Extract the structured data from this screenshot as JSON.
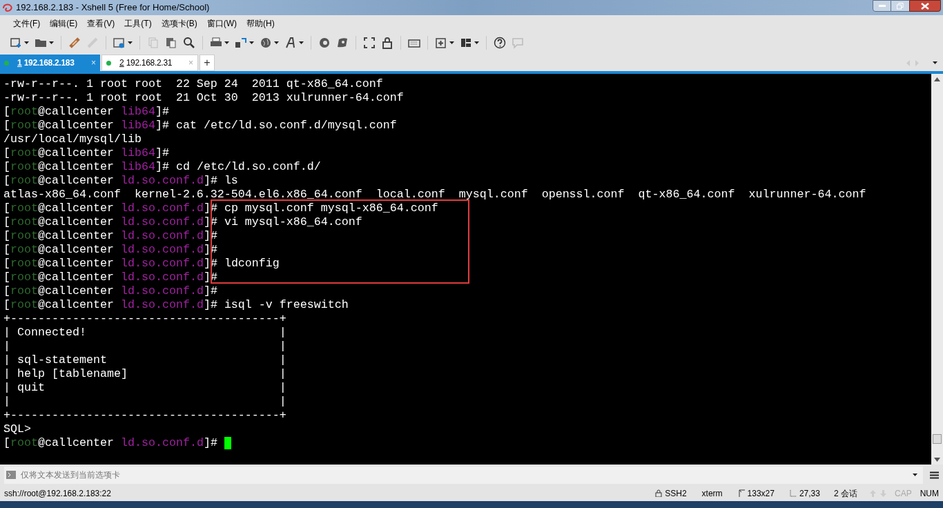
{
  "window": {
    "title": "192.168.2.183 - Xshell 5 (Free for Home/School)"
  },
  "menu": [
    "文件(F)",
    "编辑(E)",
    "查看(V)",
    "工具(T)",
    "选项卡(B)",
    "窗口(W)",
    "帮助(H)"
  ],
  "tabs": [
    {
      "number": "1",
      "label": "192.168.2.183",
      "selected": true,
      "close": "×",
      "color": "#22b14c"
    },
    {
      "number": "2",
      "label": "192.168.2.31",
      "selected": false,
      "close": "×",
      "color": "#22b14c"
    }
  ],
  "new_tab": "+",
  "terminal": {
    "lines": [
      [
        {
          "text": "-rw-r--r--. 1 root root  22 Sep 24  2011 qt-x86_64.conf",
          "color": "#ffffff"
        }
      ],
      [
        {
          "text": "-rw-r--r--. 1 root root  21 Oct 30  2013 xulrunner-64.conf",
          "color": "#ffffff"
        }
      ],
      [
        {
          "text": "[",
          "color": "#ffffff"
        },
        {
          "text": "root",
          "color": "#2e6b2e"
        },
        {
          "text": "@callcenter ",
          "color": "#ffffff"
        },
        {
          "text": "lib64",
          "color": "#a020a0"
        },
        {
          "text": "]#",
          "color": "#ffffff"
        }
      ],
      [
        {
          "text": "[",
          "color": "#ffffff"
        },
        {
          "text": "root",
          "color": "#2e6b2e"
        },
        {
          "text": "@callcenter ",
          "color": "#ffffff"
        },
        {
          "text": "lib64",
          "color": "#a020a0"
        },
        {
          "text": "]# cat /etc/ld.so.conf.d/mysql.conf",
          "color": "#ffffff"
        }
      ],
      [
        {
          "text": "/usr/local/mysql/lib",
          "color": "#ffffff"
        }
      ],
      [
        {
          "text": "[",
          "color": "#ffffff"
        },
        {
          "text": "root",
          "color": "#2e6b2e"
        },
        {
          "text": "@callcenter ",
          "color": "#ffffff"
        },
        {
          "text": "lib64",
          "color": "#a020a0"
        },
        {
          "text": "]#",
          "color": "#ffffff"
        }
      ],
      [
        {
          "text": "[",
          "color": "#ffffff"
        },
        {
          "text": "root",
          "color": "#2e6b2e"
        },
        {
          "text": "@callcenter ",
          "color": "#ffffff"
        },
        {
          "text": "lib64",
          "color": "#a020a0"
        },
        {
          "text": "]# cd /etc/ld.so.conf.d/",
          "color": "#ffffff"
        }
      ],
      [
        {
          "text": "[",
          "color": "#ffffff"
        },
        {
          "text": "root",
          "color": "#2e6b2e"
        },
        {
          "text": "@callcenter ",
          "color": "#ffffff"
        },
        {
          "text": "ld.so.conf.d",
          "color": "#a020a0"
        },
        {
          "text": "]# ls",
          "color": "#ffffff"
        }
      ],
      [
        {
          "text": "atlas-x86_64.conf  kernel-2.6.32-504.el6.x86_64.conf  local.conf  mysql.conf  openssl.conf  qt-x86_64.conf  xulrunner-64.conf",
          "color": "#ffffff"
        }
      ],
      [
        {
          "text": "[",
          "color": "#ffffff"
        },
        {
          "text": "root",
          "color": "#2e6b2e"
        },
        {
          "text": "@callcenter ",
          "color": "#ffffff"
        },
        {
          "text": "ld.so.conf.d",
          "color": "#a020a0"
        },
        {
          "text": "]",
          "color": "#ffffff"
        },
        {
          "text": "# cp mysql.conf mysql-x86_64.conf",
          "color": "#ffffff"
        }
      ],
      [
        {
          "text": "[",
          "color": "#ffffff"
        },
        {
          "text": "root",
          "color": "#2e6b2e"
        },
        {
          "text": "@callcenter ",
          "color": "#ffffff"
        },
        {
          "text": "ld.so.conf.d",
          "color": "#a020a0"
        },
        {
          "text": "]",
          "color": "#ffffff"
        },
        {
          "text": "# vi mysql-x86_64.conf",
          "color": "#ffffff"
        }
      ],
      [
        {
          "text": "[",
          "color": "#ffffff"
        },
        {
          "text": "root",
          "color": "#2e6b2e"
        },
        {
          "text": "@callcenter ",
          "color": "#ffffff"
        },
        {
          "text": "ld.so.conf.d",
          "color": "#a020a0"
        },
        {
          "text": "]",
          "color": "#ffffff"
        },
        {
          "text": "#",
          "color": "#ffffff"
        }
      ],
      [
        {
          "text": "[",
          "color": "#ffffff"
        },
        {
          "text": "root",
          "color": "#2e6b2e"
        },
        {
          "text": "@callcenter ",
          "color": "#ffffff"
        },
        {
          "text": "ld.so.conf.d",
          "color": "#a020a0"
        },
        {
          "text": "]",
          "color": "#ffffff"
        },
        {
          "text": "#",
          "color": "#ffffff"
        }
      ],
      [
        {
          "text": "[",
          "color": "#ffffff"
        },
        {
          "text": "root",
          "color": "#2e6b2e"
        },
        {
          "text": "@callcenter ",
          "color": "#ffffff"
        },
        {
          "text": "ld.so.conf.d",
          "color": "#a020a0"
        },
        {
          "text": "]",
          "color": "#ffffff"
        },
        {
          "text": "# ldconfig",
          "color": "#ffffff"
        }
      ],
      [
        {
          "text": "[",
          "color": "#ffffff"
        },
        {
          "text": "root",
          "color": "#2e6b2e"
        },
        {
          "text": "@callcenter ",
          "color": "#ffffff"
        },
        {
          "text": "ld.so.conf.d",
          "color": "#a020a0"
        },
        {
          "text": "]",
          "color": "#ffffff"
        },
        {
          "text": "#",
          "color": "#ffffff"
        }
      ],
      [
        {
          "text": "[",
          "color": "#ffffff"
        },
        {
          "text": "root",
          "color": "#2e6b2e"
        },
        {
          "text": "@callcenter ",
          "color": "#ffffff"
        },
        {
          "text": "ld.so.conf.d",
          "color": "#a020a0"
        },
        {
          "text": "]#",
          "color": "#ffffff"
        }
      ],
      [
        {
          "text": "[",
          "color": "#ffffff"
        },
        {
          "text": "root",
          "color": "#2e6b2e"
        },
        {
          "text": "@callcenter ",
          "color": "#ffffff"
        },
        {
          "text": "ld.so.conf.d",
          "color": "#a020a0"
        },
        {
          "text": "]# isql -v freeswitch",
          "color": "#ffffff"
        }
      ],
      [
        {
          "text": "+---------------------------------------+",
          "color": "#ffffff"
        }
      ],
      [
        {
          "text": "| Connected!                            |",
          "color": "#ffffff"
        }
      ],
      [
        {
          "text": "|                                       |",
          "color": "#ffffff"
        }
      ],
      [
        {
          "text": "| sql-statement                         |",
          "color": "#ffffff"
        }
      ],
      [
        {
          "text": "| help [tablename]                      |",
          "color": "#ffffff"
        }
      ],
      [
        {
          "text": "| quit                                  |",
          "color": "#ffffff"
        }
      ],
      [
        {
          "text": "|                                       |",
          "color": "#ffffff"
        }
      ],
      [
        {
          "text": "+---------------------------------------+",
          "color": "#ffffff"
        }
      ],
      [
        {
          "text": "SQL>",
          "color": "#ffffff"
        }
      ],
      [
        {
          "text": "[",
          "color": "#ffffff"
        },
        {
          "text": "root",
          "color": "#2e6b2e"
        },
        {
          "text": "@callcenter ",
          "color": "#ffffff"
        },
        {
          "text": "ld.so.conf.d",
          "color": "#a020a0"
        },
        {
          "text": "]# ",
          "color": "#ffffff"
        }
      ]
    ]
  },
  "compose_bar": {
    "placeholder": "仅将文本发送到当前选项卡"
  },
  "status_bar": {
    "connection": "ssh://root@192.168.2.183:22",
    "protocol": "SSH2",
    "terminal_type": "xterm",
    "size": "133x27",
    "cursor": "27,33",
    "sessions": "2 会话",
    "keys": [
      {
        "label": "CAP",
        "on": false
      },
      {
        "label": "NUM",
        "on": true
      }
    ]
  }
}
